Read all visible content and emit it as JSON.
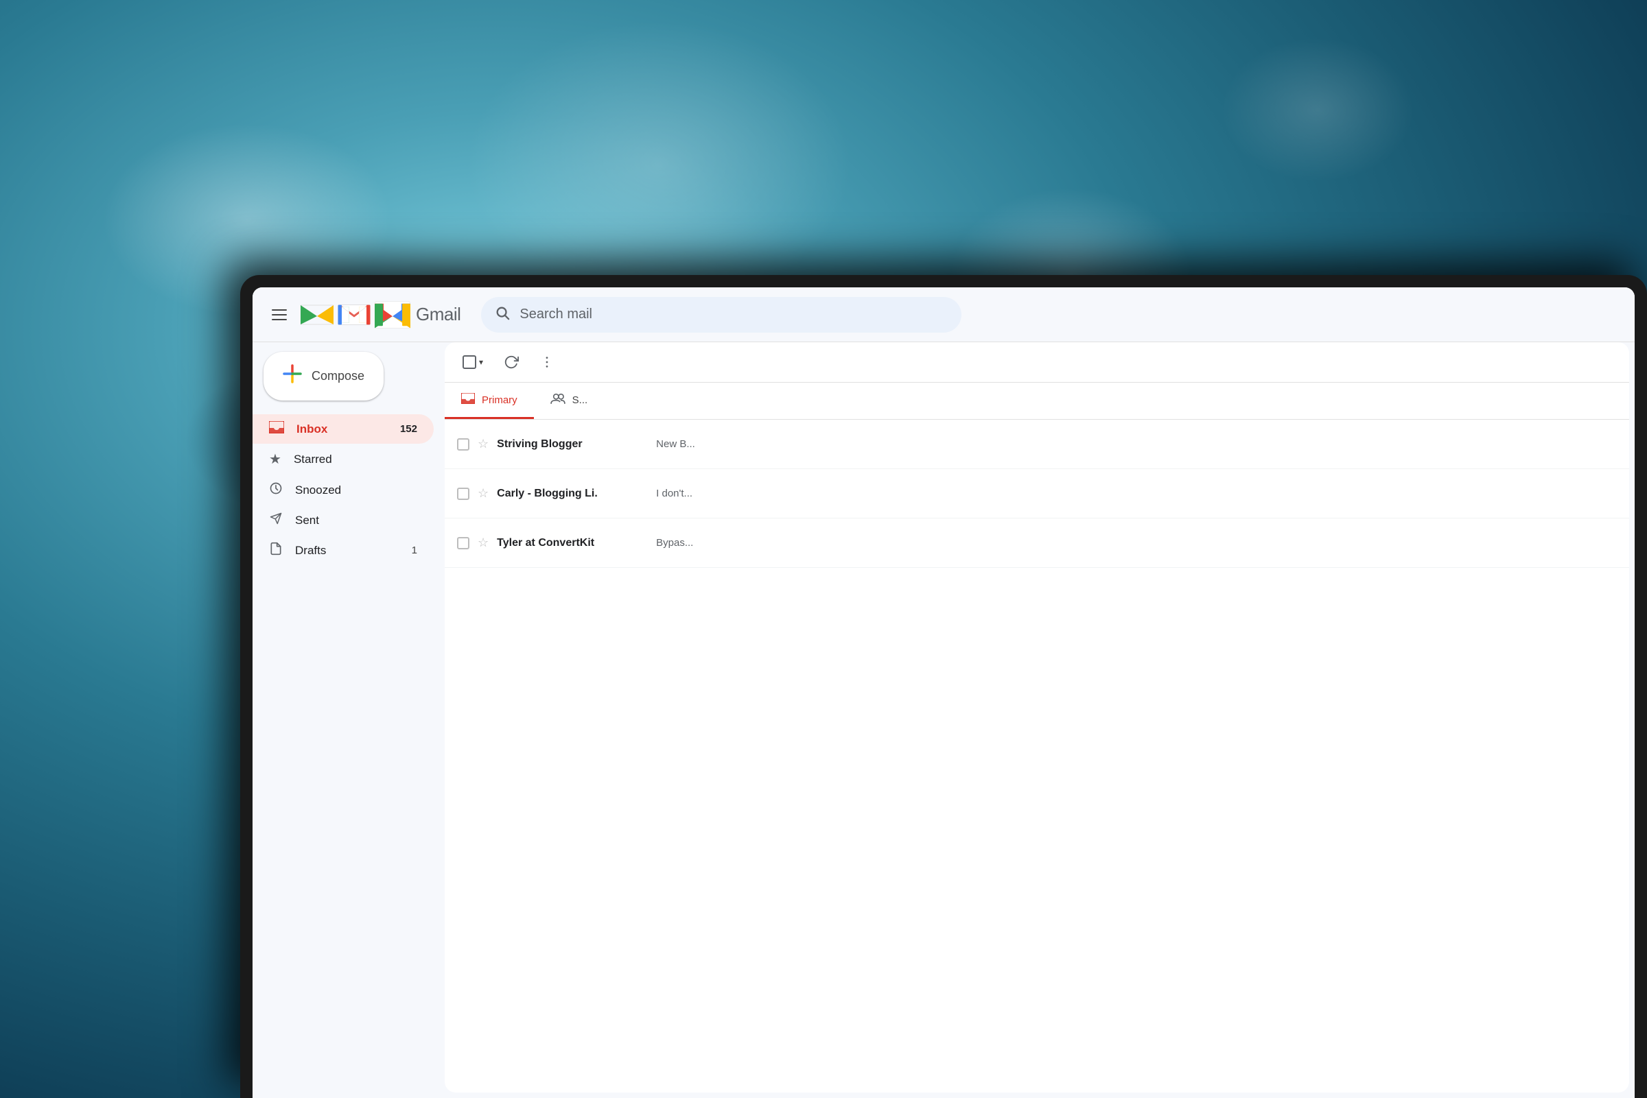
{
  "background": {
    "color_top": "#6ec6d8",
    "color_mid": "#2a8aab",
    "color_dark": "#0a2a3e"
  },
  "header": {
    "menu_label": "Main menu",
    "logo_alt": "Gmail logo",
    "app_name": "Gmail",
    "search_placeholder": "Search mail"
  },
  "compose": {
    "label": "Compose",
    "plus_symbol": "+"
  },
  "sidebar": {
    "items": [
      {
        "id": "inbox",
        "label": "Inbox",
        "badge": "152",
        "active": true
      },
      {
        "id": "starred",
        "label": "Starred",
        "badge": "",
        "active": false
      },
      {
        "id": "snoozed",
        "label": "Snoozed",
        "badge": "",
        "active": false
      },
      {
        "id": "sent",
        "label": "Sent",
        "badge": "",
        "active": false
      },
      {
        "id": "drafts",
        "label": "Drafts",
        "badge": "1",
        "active": false
      }
    ]
  },
  "toolbar": {
    "select_label": "Select",
    "refresh_label": "Refresh",
    "more_label": "More"
  },
  "tabs": [
    {
      "id": "primary",
      "label": "Primary",
      "active": true
    },
    {
      "id": "social",
      "label": "S...",
      "active": false
    }
  ],
  "emails": [
    {
      "sender": "Striving Blogger",
      "preview": "New B...",
      "starred": false
    },
    {
      "sender": "Carly - Blogging Li.",
      "preview": "I don't...",
      "starred": false
    },
    {
      "sender": "Tyler at ConvertKit",
      "preview": "Bypas...",
      "starred": false
    }
  ]
}
